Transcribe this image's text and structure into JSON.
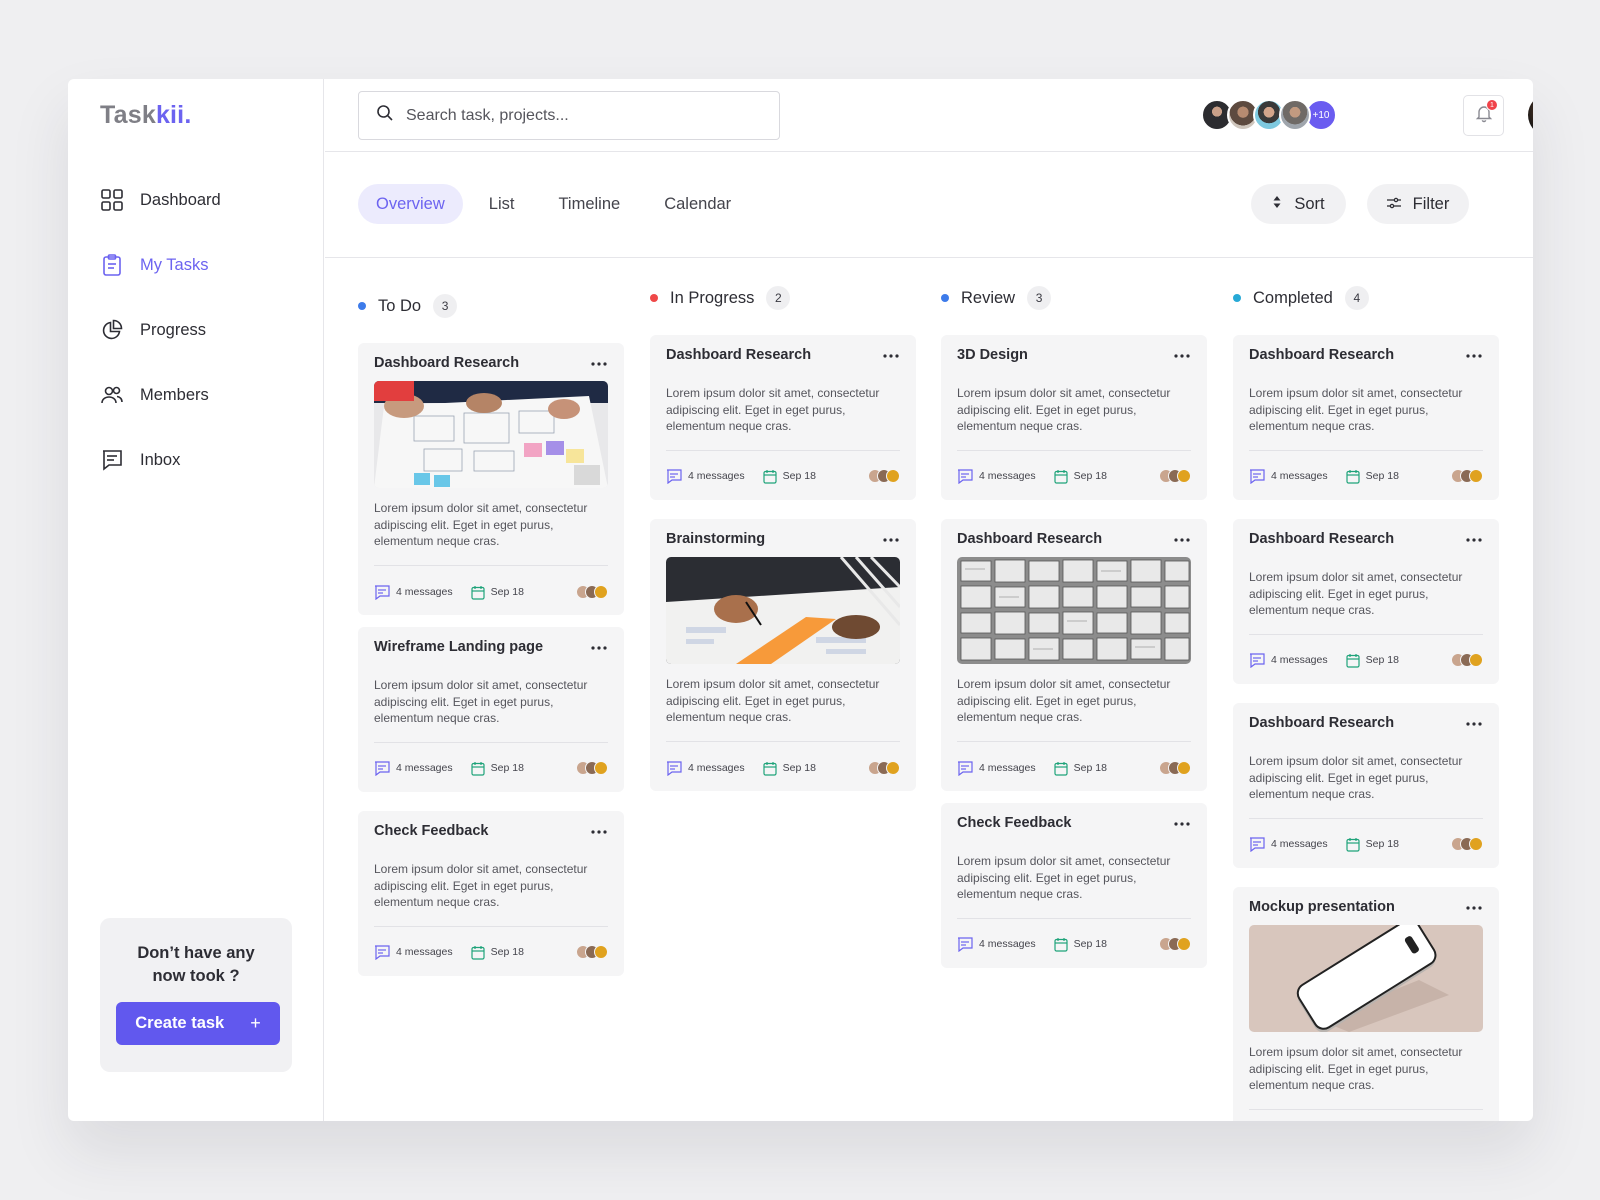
{
  "app": {
    "logo_main": "Task",
    "logo_accent": "kii."
  },
  "sidebar": {
    "items": [
      {
        "label": "Dashboard",
        "icon": "grid-icon",
        "active": false
      },
      {
        "label": "My Tasks",
        "icon": "clipboard-icon",
        "active": true
      },
      {
        "label": "Progress",
        "icon": "pie-chart-icon",
        "active": false
      },
      {
        "label": "Members",
        "icon": "users-icon",
        "active": false
      },
      {
        "label": "Inbox",
        "icon": "message-icon",
        "active": false
      }
    ],
    "promo": {
      "text": "Don’t have any now took ?",
      "button_label": "Create task",
      "button_icon": "+"
    }
  },
  "header": {
    "search_placeholder": "Search task, projects...",
    "team_more": "+10",
    "notification_count": "1"
  },
  "tabs": [
    {
      "label": "Overview",
      "active": true
    },
    {
      "label": "List",
      "active": false
    },
    {
      "label": "Timeline",
      "active": false
    },
    {
      "label": "Calendar",
      "active": false
    }
  ],
  "actions": {
    "sort_label": "Sort",
    "filter_label": "Filter"
  },
  "colors": {
    "accent": "#6c63f0",
    "todo": "#3d7bea",
    "in_progress": "#ef4848",
    "review": "#3d7bea",
    "completed": "#27a9d6"
  },
  "columns": [
    {
      "name": "To Do",
      "count": "3",
      "cards": [
        {
          "title": "Dashboard Research",
          "image": "sketch-workshop",
          "desc": "Lorem ipsum dolor sit amet, consectetur adipiscing elit. Eget in eget purus, elementum neque cras.",
          "messages": "4 messages",
          "date": "Sep 18"
        },
        {
          "title": "Wireframe Landing page",
          "image": "",
          "desc": "Lorem ipsum dolor sit amet, consectetur adipiscing elit. Eget in eget purus, elementum neque cras.",
          "messages": "4 messages",
          "date": "Sep 18"
        },
        {
          "title": "Check Feedback",
          "image": "",
          "desc": "Lorem ipsum dolor sit amet, consectetur adipiscing elit. Eget in eget purus, elementum neque cras.",
          "messages": "4 messages",
          "date": "Sep 18"
        }
      ]
    },
    {
      "name": "In Progress",
      "count": "2",
      "cards": [
        {
          "title": "Dashboard Research",
          "image": "",
          "desc": "Lorem ipsum dolor sit amet, consectetur adipiscing elit. Eget in eget purus, elementum neque cras.",
          "messages": "4 messages",
          "date": "Sep 18"
        },
        {
          "title": "Brainstorming",
          "image": "brainstorm-desk",
          "desc": "Lorem ipsum dolor sit amet, consectetur adipiscing elit. Eget in eget purus, elementum neque cras.",
          "messages": "4 messages",
          "date": "Sep 18"
        }
      ]
    },
    {
      "name": "Review",
      "count": "3",
      "cards": [
        {
          "title": "3D Design",
          "image": "",
          "desc": "Lorem ipsum dolor sit amet, consectetur adipiscing elit. Eget in eget purus, elementum neque cras.",
          "messages": "4 messages",
          "date": "Sep 18"
        },
        {
          "title": "Dashboard Research",
          "image": "wireframe-sheets",
          "desc": "Lorem ipsum dolor sit amet, consectetur adipiscing elit. Eget in eget purus, elementum neque cras.",
          "messages": "4 messages",
          "date": "Sep 18"
        },
        {
          "title": "Check Feedback",
          "image": "",
          "desc": "Lorem ipsum dolor sit amet, consectetur adipiscing elit. Eget in eget purus, elementum neque cras.",
          "messages": "4 messages",
          "date": "Sep 18"
        }
      ]
    },
    {
      "name": "Completed",
      "count": "4",
      "cards": [
        {
          "title": "Dashboard Research",
          "image": "",
          "desc": "Lorem ipsum dolor sit amet, consectetur adipiscing elit. Eget in eget purus, elementum neque cras.",
          "messages": "4 messages",
          "date": "Sep 18"
        },
        {
          "title": "Dashboard Research",
          "image": "",
          "desc": "Lorem ipsum dolor sit amet, consectetur adipiscing elit. Eget in eget purus, elementum neque cras.",
          "messages": "4 messages",
          "date": "Sep 18"
        },
        {
          "title": "Dashboard Research",
          "image": "",
          "desc": "Lorem ipsum dolor sit amet, consectetur adipiscing elit. Eget in eget purus, elementum neque cras.",
          "messages": "4 messages",
          "date": "Sep 18"
        },
        {
          "title": "Mockup presentation",
          "image": "phone-mockup",
          "desc": "Lorem ipsum dolor sit amet, consectetur adipiscing elit. Eget in eget purus, elementum neque cras.",
          "messages": "",
          "date": ""
        }
      ]
    }
  ]
}
